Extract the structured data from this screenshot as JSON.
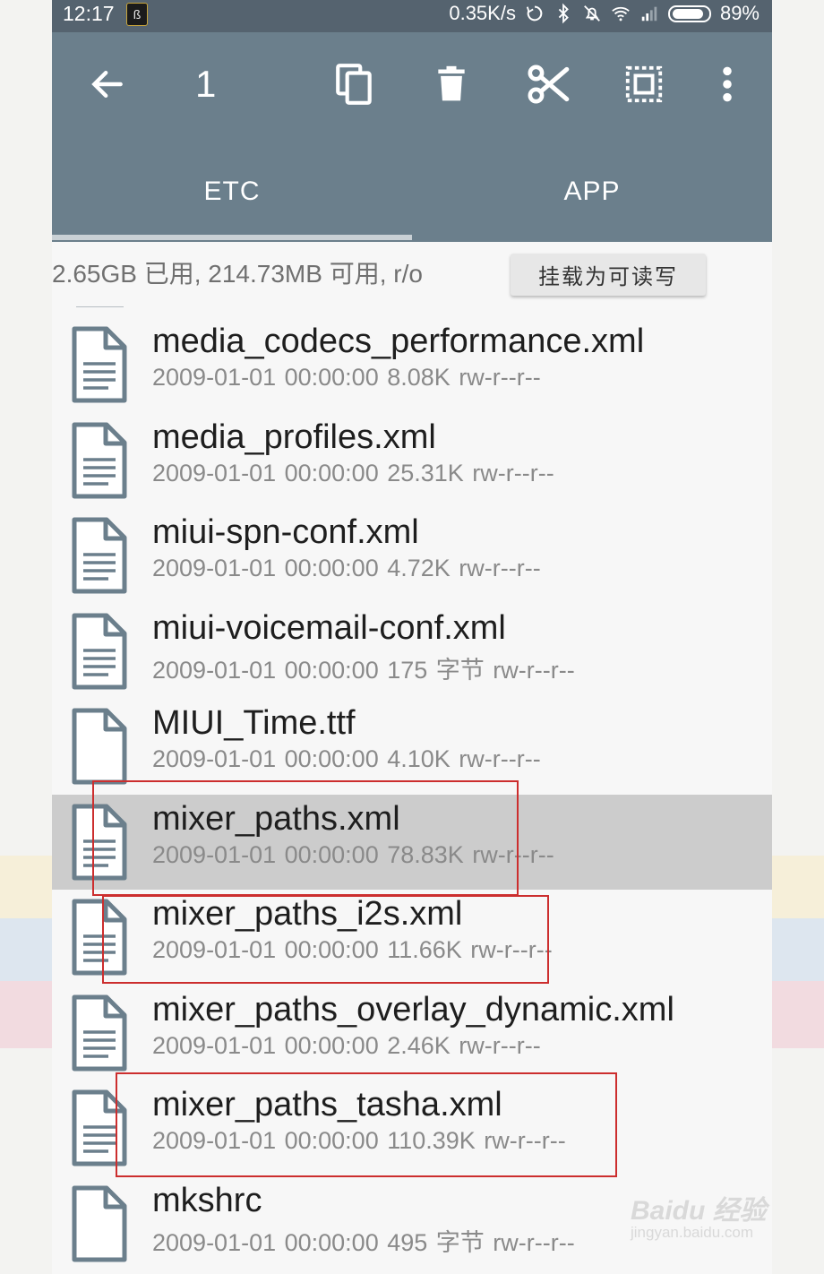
{
  "status_bar": {
    "time": "12:17",
    "notification_badge": "ß",
    "net_speed": "0.35K/s",
    "battery_percent": "89%",
    "icons": [
      "sync-icon",
      "bluetooth-icon",
      "mute-icon",
      "wifi-icon",
      "signal-icon",
      "battery-icon"
    ]
  },
  "toolbar": {
    "selected_count": "1",
    "icons": [
      "back-arrow-icon",
      "copy-icon",
      "delete-icon",
      "cut-icon",
      "select-all-icon",
      "more-icon"
    ]
  },
  "tabs": [
    {
      "label": "ETC",
      "active": true
    },
    {
      "label": "APP",
      "active": false
    }
  ],
  "storage": {
    "info": "2.65GB 已用, 214.73MB 可用, r/o",
    "mount_button": "挂载为可读写"
  },
  "files": [
    {
      "name": "media_codecs_performance.xml",
      "meta": "2009-01-01 00:00:00  8.08K  rw-r--r--",
      "icon": "text-file-icon",
      "selected": false
    },
    {
      "name": "media_profiles.xml",
      "meta": "2009-01-01 00:00:00  25.31K  rw-r--r--",
      "icon": "text-file-icon",
      "selected": false
    },
    {
      "name": "miui-spn-conf.xml",
      "meta": "2009-01-01 00:00:00  4.72K  rw-r--r--",
      "icon": "text-file-icon",
      "selected": false
    },
    {
      "name": "miui-voicemail-conf.xml",
      "meta": "2009-01-01 00:00:00  175 字节  rw-r--r--",
      "icon": "text-file-icon",
      "selected": false
    },
    {
      "name": "MIUI_Time.ttf",
      "meta": "2009-01-01 00:00:00  4.10K  rw-r--r--",
      "icon": "blank-file-icon",
      "selected": false
    },
    {
      "name": "mixer_paths.xml",
      "meta": "2009-01-01 00:00:00  78.83K  rw-r--r--",
      "icon": "text-file-icon",
      "selected": true
    },
    {
      "name": "mixer_paths_i2s.xml",
      "meta": "2009-01-01 00:00:00  11.66K  rw-r--r--",
      "icon": "text-file-icon",
      "selected": false
    },
    {
      "name": "mixer_paths_overlay_dynamic.xml",
      "meta": "2009-01-01 00:00:00  2.46K  rw-r--r--",
      "icon": "text-file-icon",
      "selected": false
    },
    {
      "name": "mixer_paths_tasha.xml",
      "meta": "2009-01-01 00:00:00  110.39K  rw-r--r--",
      "icon": "text-file-icon",
      "selected": false
    },
    {
      "name": "mkshrc",
      "meta": "2009-01-01 00:00:00  495 字节  rw-r--r--",
      "icon": "blank-file-icon",
      "selected": false
    }
  ],
  "watermark": {
    "brand": "Baidu 经验",
    "url": "jingyan.baidu.com"
  },
  "colors": {
    "toolbar": "#6b7f8c",
    "status_bar": "#55636f",
    "selected_row": "#cccccc",
    "annotation": "#cc2e2e",
    "icon": "#6b7f8c"
  }
}
